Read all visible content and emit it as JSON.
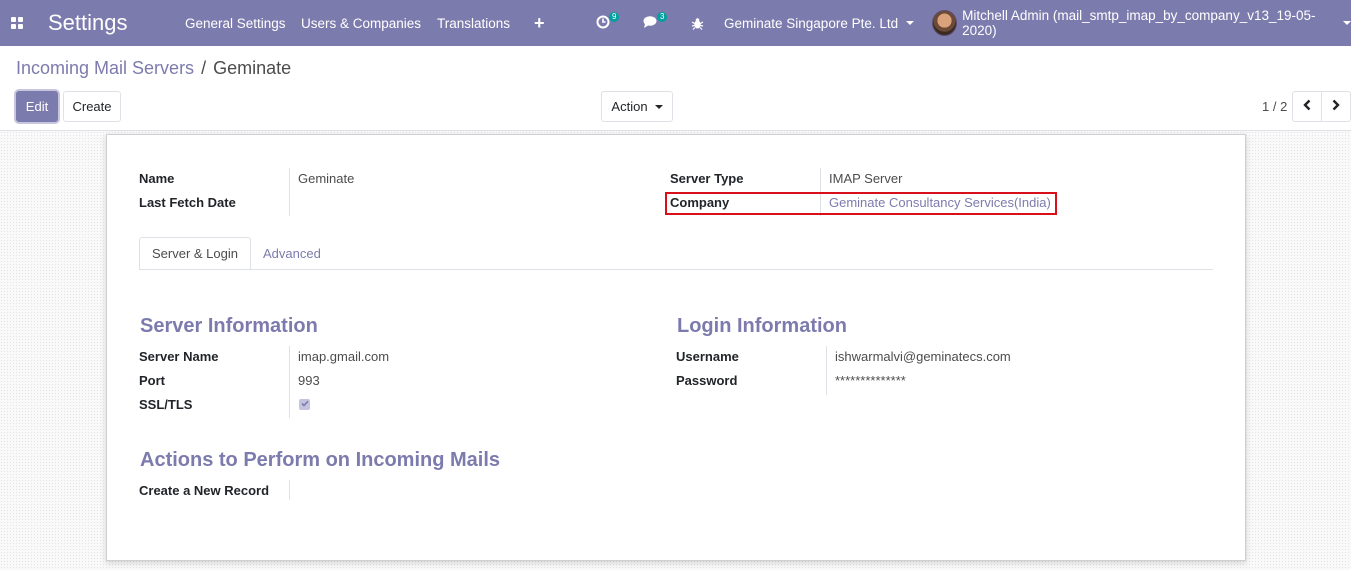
{
  "navbar": {
    "brand": "Settings",
    "menu": [
      "General Settings",
      "Users & Companies",
      "Translations"
    ],
    "plus": "+",
    "activity_count": "9",
    "messages_count": "3",
    "company": "Geminate Singapore Pte. Ltd",
    "user": "Mitchell Admin (mail_smtp_imap_by_company_v13_19-05-2020)"
  },
  "control_panel": {
    "breadcrumb_parent": "Incoming Mail Servers",
    "breadcrumb_sep": "/",
    "breadcrumb_current": "Geminate",
    "edit": "Edit",
    "create": "Create",
    "action": "Action",
    "pager": "1 / 2"
  },
  "form": {
    "name_label": "Name",
    "name_value": "Geminate",
    "last_fetch_label": "Last Fetch Date",
    "last_fetch_value": "",
    "server_type_label": "Server Type",
    "server_type_value": "IMAP Server",
    "company_label": "Company",
    "company_value": "Geminate Consultancy Services(India)",
    "tabs": [
      "Server & Login",
      "Advanced"
    ],
    "server_info_title": "Server Information",
    "server_name_label": "Server Name",
    "server_name_value": "imap.gmail.com",
    "port_label": "Port",
    "port_value": "993",
    "ssl_label": "SSL/TLS",
    "ssl_checked": true,
    "login_info_title": "Login Information",
    "username_label": "Username",
    "username_value": "ishwarmalvi@geminatecs.com",
    "password_label": "Password",
    "password_value": "**************",
    "actions_title": "Actions to Perform on Incoming Mails",
    "create_record_label": "Create a New Record",
    "create_record_value": ""
  },
  "colors": {
    "navbar": "#7c7bad",
    "accent": "#7c7bad",
    "highlight_box": "#d9101c"
  },
  "icons": [
    "apps-icon",
    "plus-icon",
    "activity-icon",
    "messages-icon",
    "debug-bug-icon",
    "caret-down-icon",
    "chevron-left-icon",
    "chevron-right-icon",
    "check-icon"
  ]
}
